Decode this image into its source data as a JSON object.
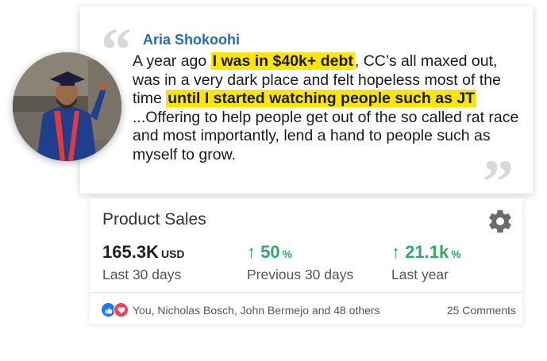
{
  "testimonial": {
    "author": "Aria Shokoohi",
    "text_1": "A year ago ",
    "highlight_1": "I was in $40k+ debt",
    "text_2": ", CC’s all maxed out, was in a very dark place and felt hopeless most of the time ",
    "highlight_2": "until I started watching people such as JT",
    "text_3": " ...Offering to help people get out of the so called rat race and most importantly, lend a hand to people such as myself to grow.",
    "open_quote": "“",
    "close_quote": "”",
    "highlight_color": "#ffe600",
    "author_color": "#1e6fb8"
  },
  "sales": {
    "title": "Product Sales",
    "settings_icon": "gear-icon",
    "metrics": [
      {
        "value": "165.3K",
        "unit": "USD",
        "label": "Last 30 days",
        "arrow": ""
      },
      {
        "value": "50",
        "unit": "%",
        "label": "Previous 30 days",
        "arrow": "↑"
      },
      {
        "value": "21.1k",
        "unit": "%",
        "label": "Last year",
        "arrow": "↑"
      }
    ],
    "positive_color": "#2fa86a",
    "reactions_text": "You, Nicholas Bosch, John Bermejo and 48 others",
    "comments_text": "25 Comments"
  }
}
